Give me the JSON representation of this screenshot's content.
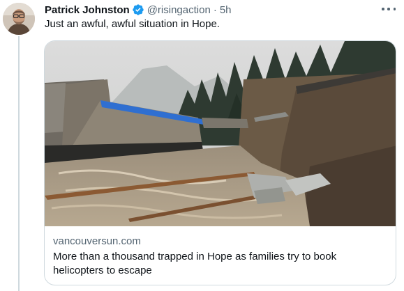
{
  "tweet": {
    "author_name": "Patrick Johnston",
    "handle": "@risingaction",
    "separator": "·",
    "timestamp": "5h",
    "text": "Just an awful, awful situation in Hope.",
    "verified": true
  },
  "icons": {
    "verified": "verified-badge-icon",
    "more": "more-options-icon"
  },
  "link_card": {
    "domain": "vancouversun.com",
    "title": "More than a thousand trapped in Hope as families try to book helicopters to escape",
    "image": "washed-out-bridge-flood-photo"
  },
  "colors": {
    "verified_blue": "#1d9bf0",
    "secondary_text": "#536471",
    "border": "#cfd9de"
  }
}
